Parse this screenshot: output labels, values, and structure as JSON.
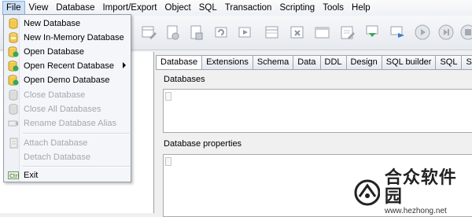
{
  "menubar": {
    "items": [
      "File",
      "View",
      "Database",
      "Import/Export",
      "Object",
      "SQL",
      "Transaction",
      "Scripting",
      "Tools",
      "Help"
    ]
  },
  "file_menu": {
    "items": [
      {
        "label": "New Database",
        "icon": "db-new-icon",
        "disabled": false
      },
      {
        "label": "New In-Memory Database",
        "icon": "db-memory-icon",
        "disabled": false
      },
      {
        "label": "Open Database",
        "icon": "db-open-icon",
        "disabled": false
      },
      {
        "label": "Open Recent Database",
        "icon": "db-recent-icon",
        "disabled": false,
        "submenu": true
      },
      {
        "label": "Open Demo Database",
        "icon": "db-demo-icon",
        "disabled": false
      },
      {
        "label": "Close Database",
        "icon": "db-close-icon",
        "disabled": true
      },
      {
        "label": "Close All Databases",
        "icon": "db-close-all-icon",
        "disabled": true
      },
      {
        "label": "Rename Database Alias",
        "icon": "rename-icon",
        "disabled": true
      },
      {
        "label": "Attach Database",
        "icon": "attach-icon",
        "disabled": true
      },
      {
        "label": "Detach Database",
        "icon": "",
        "disabled": true
      },
      {
        "label": "Exit",
        "icon": "exit-icon",
        "disabled": false
      }
    ]
  },
  "tabs": [
    "Database",
    "Extensions",
    "Schema",
    "Data",
    "DDL",
    "Design",
    "SQL builder",
    "SQL",
    "Scripting"
  ],
  "selected_tab": "Database",
  "panels": {
    "databases_label": "Databases",
    "properties_label": "Database properties"
  },
  "watermark": {
    "text": "合众软件园",
    "url": "www.hezhong.net"
  },
  "colors": {
    "menu_highlight": "#cde0f5",
    "db_icon_yellow": "#f2c94c",
    "green_arrow": "#3aa655",
    "disabled_text": "#a4a8ae"
  }
}
